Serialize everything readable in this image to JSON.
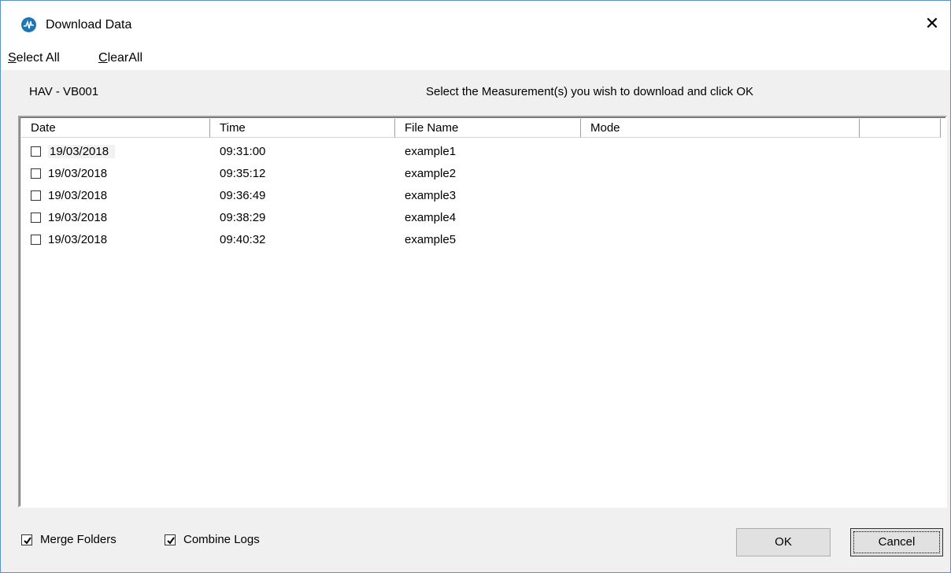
{
  "window": {
    "title": "Download Data",
    "close_glyph": "✕",
    "icon": "app-logo-icon"
  },
  "menu": {
    "select_all_first": "S",
    "select_all_rest": "elect All",
    "clear_all_first": "C",
    "clear_all_rest": "learAll"
  },
  "device_label": "HAV - VB001",
  "instruction": "Select the Measurement(s) you wish to download and click OK",
  "table": {
    "columns": [
      "Date",
      "Time",
      "File Name",
      "Mode",
      ""
    ],
    "rows": [
      {
        "date": "19/03/2018",
        "time": "09:31:00",
        "file": "example1",
        "mode": "",
        "checked": false
      },
      {
        "date": "19/03/2018",
        "time": "09:35:12",
        "file": "example2",
        "mode": "",
        "checked": false
      },
      {
        "date": "19/03/2018",
        "time": "09:36:49",
        "file": "example3",
        "mode": "",
        "checked": false
      },
      {
        "date": "19/03/2018",
        "time": "09:38:29",
        "file": "example4",
        "mode": "",
        "checked": false
      },
      {
        "date": "19/03/2018",
        "time": "09:40:32",
        "file": "example5",
        "mode": "",
        "checked": false
      }
    ]
  },
  "options": {
    "merge_folders": {
      "label": "Merge Folders",
      "checked": true
    },
    "combine_logs": {
      "label": "Combine Logs",
      "checked": true
    }
  },
  "buttons": {
    "ok": "OK",
    "cancel": "Cancel"
  },
  "colors": {
    "window_border": "#5a8fd0",
    "icon_blue": "#1d74b6",
    "dialog_bg": "#f0f0f0"
  }
}
